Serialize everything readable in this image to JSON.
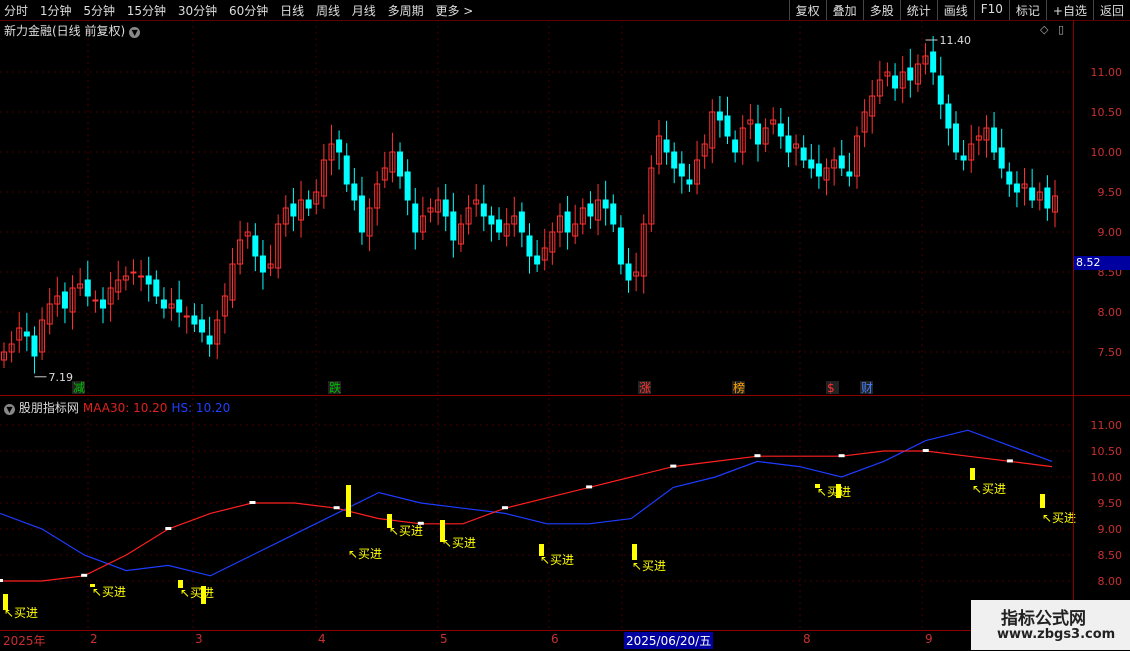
{
  "toolbar": {
    "periods": [
      "分时",
      "1分钟",
      "5分钟",
      "15分钟",
      "30分钟",
      "60分钟",
      "日线",
      "周线",
      "月线",
      "多周期",
      "更多 >"
    ],
    "tools": [
      "复权",
      "叠加",
      "多股",
      "统计",
      "画线",
      "F10",
      "标记",
      "+自选",
      "返回"
    ]
  },
  "chart_title": "新力金融(日线 前复权)",
  "price_axis": [
    "11.00",
    "10.50",
    "10.00",
    "9.50",
    "9.00",
    "8.50",
    "8.00",
    "7.50"
  ],
  "current_price_tag": "8.52",
  "high_label": "11.40",
  "low_label": "7.19",
  "event_markers": [
    "减",
    "跌",
    "涨",
    "榜",
    "$",
    "财"
  ],
  "indicator": {
    "name": "股朋指标网",
    "ma_label": "MAA30: 10.20",
    "hs_label": "HS: 10.20",
    "axis": [
      "11.00",
      "10.50",
      "10.00",
      "9.50",
      "9.00",
      "8.50",
      "8.00"
    ],
    "signal_label": "买进"
  },
  "date_axis": [
    "2025年",
    "2",
    "3",
    "4",
    "5",
    "6",
    "2025/06/20/五",
    "8",
    "9"
  ],
  "watermark": {
    "line1": "指标公式网",
    "line2": "www.zbgs3.com"
  },
  "colors": {
    "up": "#ff3232",
    "down": "#00ffff",
    "ma": "#ff2020",
    "hs": "#1e3cff",
    "signal": "#ffff00",
    "grid": "#8b0000"
  },
  "chart_data": {
    "type": "candlestick",
    "series": [
      {
        "name": "price_close",
        "values": [
          7.5,
          7.6,
          7.8,
          7.7,
          7.45,
          7.9,
          8.1,
          8.2,
          8.05,
          8.3,
          8.35,
          8.2,
          8.15,
          8.05,
          8.3,
          8.4,
          8.45,
          8.5,
          8.45,
          8.35,
          8.2,
          8.05,
          8.1,
          8.0,
          7.95,
          7.85,
          7.75,
          7.6,
          7.9,
          8.2,
          8.6,
          8.9,
          9.0,
          8.7,
          8.5,
          8.6,
          9.1,
          9.3,
          9.2,
          9.4,
          9.3,
          9.5,
          9.9,
          10.1,
          10.0,
          9.6,
          9.4,
          9.0,
          9.3,
          9.6,
          9.8,
          10.0,
          9.7,
          9.4,
          9.0,
          9.2,
          9.3,
          9.4,
          9.2,
          8.9,
          9.1,
          9.3,
          9.4,
          9.2,
          9.1,
          9.0,
          9.1,
          9.2,
          9.0,
          8.7,
          8.6,
          8.8,
          9.0,
          9.2,
          9.0,
          9.1,
          9.3,
          9.2,
          9.4,
          9.3,
          9.1,
          8.6,
          8.4,
          8.5,
          9.1,
          9.8,
          10.2,
          10.0,
          9.8,
          9.7,
          9.6,
          9.9,
          10.1,
          10.5,
          10.4,
          10.2,
          10.0,
          10.3,
          10.4,
          10.1,
          10.3,
          10.4,
          10.2,
          10.0,
          10.1,
          9.9,
          9.8,
          9.7,
          9.8,
          9.9,
          9.8,
          9.7,
          10.2,
          10.5,
          10.7,
          10.9,
          11.0,
          10.8,
          11.0,
          10.9,
          11.1,
          11.2,
          11.0,
          10.6,
          10.3,
          10.0,
          9.9,
          10.1,
          10.2,
          10.3,
          10.0,
          9.8,
          9.6,
          9.5,
          9.6,
          9.4,
          9.5,
          9.3,
          9.45
        ]
      },
      {
        "name": "MAA30",
        "values": [
          8.0,
          8.0,
          8.1,
          8.5,
          9.0,
          9.3,
          9.5,
          9.5,
          9.4,
          9.2,
          9.1,
          9.1,
          9.4,
          9.6,
          9.8,
          10.0,
          10.2,
          10.3,
          10.4,
          10.4,
          10.4,
          10.5,
          10.5,
          10.4,
          10.3,
          10.2
        ]
      },
      {
        "name": "HS",
        "values": [
          9.3,
          9.0,
          8.5,
          8.2,
          8.3,
          8.1,
          8.5,
          8.9,
          9.3,
          9.7,
          9.5,
          9.4,
          9.3,
          9.1,
          9.1,
          9.2,
          9.8,
          10.0,
          10.3,
          10.2,
          10.0,
          10.3,
          10.7,
          10.9,
          10.6,
          10.3
        ]
      }
    ]
  }
}
